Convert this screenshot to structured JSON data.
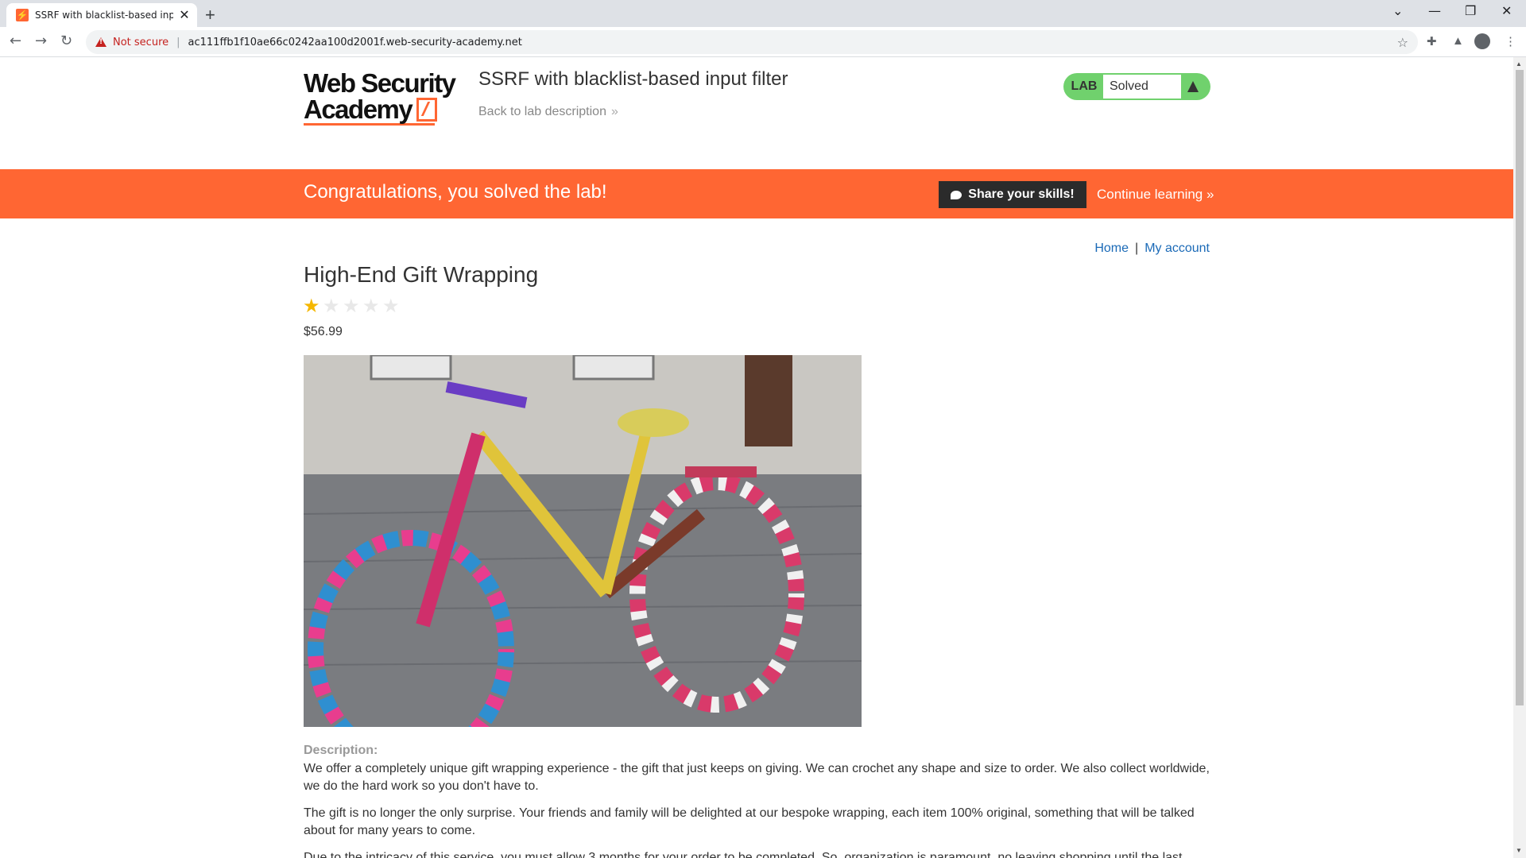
{
  "browser": {
    "tab_title": "SSRF with blacklist-based input f",
    "not_secure": "Not secure",
    "url": "ac111ffb1f10ae66c0242aa100d2001f.web-security-academy.net"
  },
  "header": {
    "logo_line1": "Web Security",
    "logo_line2": "Academy",
    "lab_title": "SSRF with blacklist-based input filter",
    "back_link": "Back to lab description",
    "lab_tag": "LAB",
    "lab_state": "Solved"
  },
  "banner": {
    "message": "Congratulations, you solved the lab!",
    "share_label": "Share your skills!",
    "continue_label": "Continue learning"
  },
  "nav": {
    "home": "Home",
    "separator": "|",
    "account": "My account"
  },
  "product": {
    "name": "High-End Gift Wrapping",
    "rating": 1,
    "max_rating": 5,
    "price": "$56.99",
    "description_label": "Description:",
    "description": [
      "We offer a completely unique gift wrapping experience - the gift that just keeps on giving. We can crochet any shape and size to order. We also collect worldwide, we do the hard work so you don't have to.",
      "The gift is no longer the only surprise. Your friends and family will be delighted at our bespoke wrapping, each item 100% original, something that will be talked about for many years to come.",
      "Due to the intricacy of this service, you must allow 3 months for your order to be completed. So, organization is paramount, no leaving shopping until the last"
    ]
  },
  "colors": {
    "accent": "#ff6633",
    "lab_solved": "#70d16d",
    "link": "#1b6ab7",
    "star": "#f5b700"
  },
  "icons": {
    "back": "arrow-left-icon",
    "forward": "arrow-right-icon",
    "reload": "reload-icon",
    "warning": "warning-icon",
    "bookmark": "star-icon",
    "extensions": "puzzle-icon",
    "lab": "flask-icon",
    "twitter": "twitter-bird-icon"
  }
}
